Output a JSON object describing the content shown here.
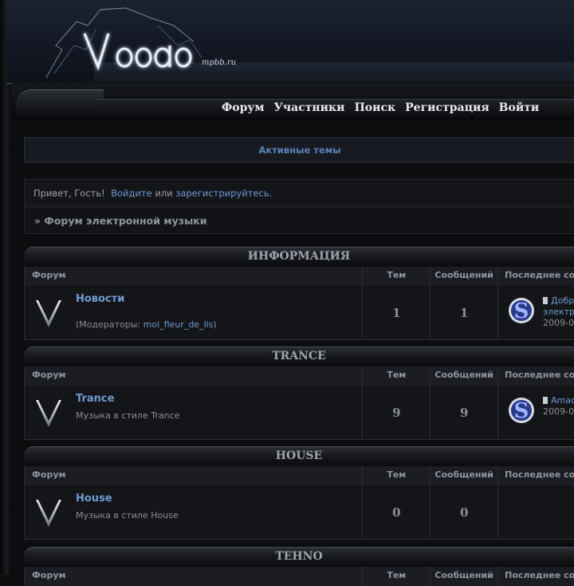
{
  "header": {
    "logo_text": "Voodoo",
    "domain": "mpbb.ru"
  },
  "nav": {
    "items": [
      {
        "label": "Форум"
      },
      {
        "label": "Участники"
      },
      {
        "label": "Поиск"
      },
      {
        "label": "Регистрация"
      },
      {
        "label": "Войти"
      }
    ]
  },
  "active_topics": "Активные темы",
  "greeting": {
    "prefix": "Привет, Гость!",
    "login": "Войдите",
    "or": "или",
    "register": "зарегистрируйтесь",
    "dot": "."
  },
  "breadcrumb": "» Форум электронной музыки",
  "columns": {
    "forum": "Форум",
    "topics": "Тем",
    "posts": "Сообщений",
    "last": "Последнее сообщение"
  },
  "categories": [
    {
      "title": "ИНФОРМАЦИЯ",
      "forums": [
        {
          "name": "Новости",
          "description": "",
          "moderators_label": "(Модераторы:",
          "moderator": "moi_fleur_de_lis",
          "moderators_close": ")",
          "topics": "1",
          "posts": "1",
          "last_line1": "Добр",
          "last_line2": "электр",
          "last_date": "2009-0"
        }
      ]
    },
    {
      "title": "TRANCE",
      "forums": [
        {
          "name": "Trance",
          "description": "Музыка в стиле Trance",
          "topics": "9",
          "posts": "9",
          "last_line1": "Amac",
          "last_date": "2009-0"
        }
      ]
    },
    {
      "title": "HOUSE",
      "forums": [
        {
          "name": "House",
          "description": "Музыка в стиле House",
          "topics": "0",
          "posts": "0"
        }
      ]
    },
    {
      "title": "TEHNO"
    }
  ],
  "colors": {
    "link": "#6f9ad2",
    "background": "#0c0d0f",
    "header_glow": "#7fb0ff"
  }
}
